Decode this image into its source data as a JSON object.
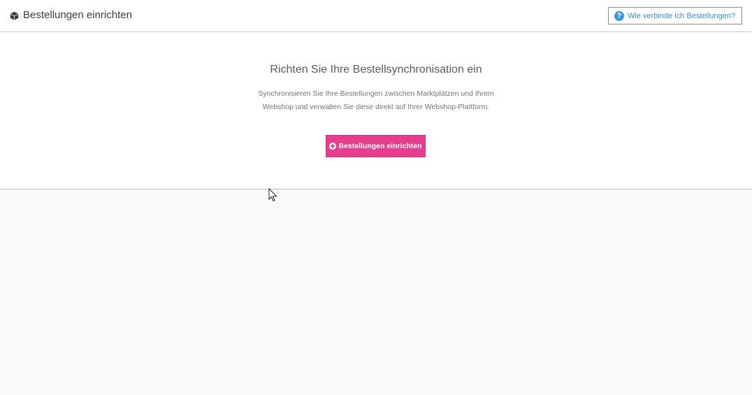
{
  "header": {
    "title": "Bestellungen einrichten",
    "title_icon": "box-icon",
    "help_button": {
      "label": "Wie verbinde ich Bestellungen?",
      "icon": "question-circle-icon",
      "icon_glyph": "?"
    }
  },
  "main": {
    "heading": "Richten Sie Ihre Bestellsynchronisation ein",
    "description": "Synchronisieren Sie Ihre Bestellungen zwischen Marktplätzen und Ihrem Webshop und verwalten Sie diese direkt auf Ihrer Webshop-Plattform.",
    "setup_button": {
      "label": "Bestellungen einrichten",
      "icon": "plus-circle-icon"
    }
  },
  "colors": {
    "accent": "#e73d8e",
    "link": "#3a8fc8",
    "help_icon": "#3a9ad9",
    "background": "#f8f8f8"
  }
}
